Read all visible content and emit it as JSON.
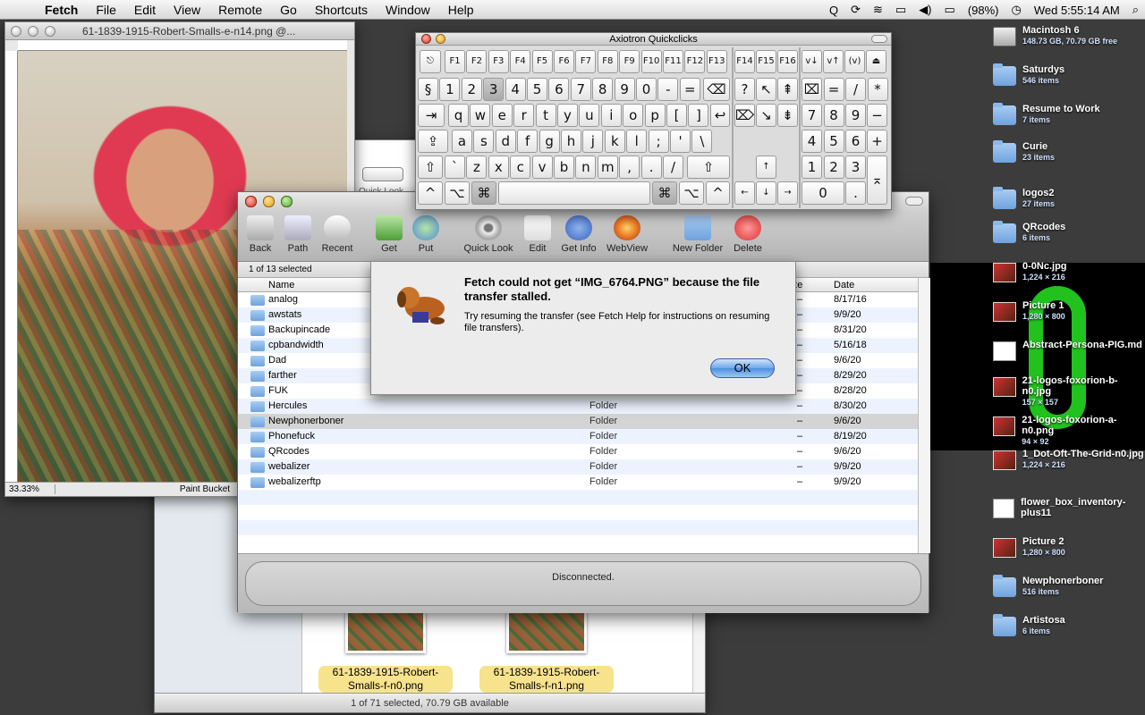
{
  "menubar": {
    "app": "Fetch",
    "items": [
      "File",
      "Edit",
      "View",
      "Remote",
      "Go",
      "Shortcuts",
      "Window",
      "Help"
    ],
    "battery": "(98%)",
    "clock": "Wed 5:55:14 AM"
  },
  "desktop": {
    "items": [
      {
        "name": "Macintosh 6",
        "sub": "148.73 GB, 70.79 GB free",
        "kind": "disk"
      },
      {
        "name": "Saturdys",
        "sub": "546 items",
        "kind": "folder"
      },
      {
        "name": "Resume to Work",
        "sub": "7 items",
        "kind": "folder"
      },
      {
        "name": "Curie",
        "sub": "23 items",
        "kind": "folder"
      },
      {
        "name": "logos2",
        "sub": "27 items",
        "kind": "folder"
      },
      {
        "name": "QRcodes",
        "sub": "6 items",
        "kind": "folder"
      },
      {
        "name": "0-0Nc.jpg",
        "sub": "1,224 × 216",
        "kind": "image"
      },
      {
        "name": "Picture 1",
        "sub": "1,280 × 800",
        "kind": "image"
      },
      {
        "name": "Abstract-Persona-PIG.md",
        "sub": "",
        "kind": "file"
      },
      {
        "name": "21-logos-foxorion-b-n0.jpg",
        "sub": "157 × 157",
        "kind": "image"
      },
      {
        "name": "21-logos-foxorion-a-n0.png",
        "sub": "94 × 92",
        "kind": "image"
      },
      {
        "name": "1_Dot-Oft-The-Grid-n0.jpg",
        "sub": "1,224 × 216",
        "kind": "image"
      },
      {
        "name": "flower_box_inventory-plus11",
        "sub": "",
        "kind": "file"
      },
      {
        "name": "Picture 2",
        "sub": "1,280 × 800",
        "kind": "image"
      },
      {
        "name": "Newphonerboner",
        "sub": "516 items",
        "kind": "folder"
      },
      {
        "name": "Artistosa",
        "sub": "6 items",
        "kind": "folder"
      }
    ]
  },
  "editor": {
    "title": "61-1839-1915-Robert-Smalls-e-n14.png @...",
    "zoom": "33.33%",
    "tool": "Paint Bucket"
  },
  "finder_back": {
    "quicklook": "Quick Look",
    "thumbs": [
      {
        "label": "61-1839-1915-Robert-Smalls-f-n0.png"
      },
      {
        "label": "61-1839-1915-Robert-Smalls-f-n1.png"
      }
    ],
    "status": "1 of 71 selected, 70.79 GB available"
  },
  "quickclicks": {
    "title": "Axiotron Quickclicks",
    "fkeys": [
      "F1",
      "F2",
      "F3",
      "F4",
      "F5",
      "F6",
      "F7",
      "F8",
      "F9",
      "F10",
      "F11",
      "F12",
      "F13",
      "F14",
      "F15",
      "F16"
    ],
    "num_row": [
      "§",
      "1",
      "2",
      "3",
      "4",
      "5",
      "6",
      "7",
      "8",
      "9",
      "0",
      "-",
      "="
    ],
    "q_row": [
      "q",
      "w",
      "e",
      "r",
      "t",
      "y",
      "u",
      "i",
      "o",
      "p",
      "[",
      "]"
    ],
    "a_row": [
      "a",
      "s",
      "d",
      "f",
      "g",
      "h",
      "j",
      "k",
      "l",
      ";",
      "'",
      "\\"
    ],
    "z_row": [
      "`",
      "z",
      "x",
      "c",
      "v",
      "b",
      "n",
      "m",
      ",",
      ".",
      "/"
    ],
    "keypad": [
      "7",
      "8",
      "9",
      "4",
      "5",
      "6",
      "1",
      "2",
      "3",
      "0",
      "."
    ]
  },
  "fetch": {
    "toolbar": [
      "Back",
      "Path",
      "Recent",
      "Get",
      "Put",
      "Quick Look",
      "Edit",
      "Get Info",
      "WebView",
      "New Folder",
      "Delete"
    ],
    "selection": "1 of 13 selected",
    "columns": {
      "name": "Name",
      "size": "Size",
      "date": "Date"
    },
    "rows": [
      {
        "name": "analog",
        "kind": "Folder",
        "size": "–",
        "date": "8/17/16"
      },
      {
        "name": "awstats",
        "kind": "Folder",
        "size": "–",
        "date": "9/9/20"
      },
      {
        "name": "Backupincade",
        "kind": "Folder",
        "size": "–",
        "date": "8/31/20"
      },
      {
        "name": "cpbandwidth",
        "kind": "Folder",
        "size": "–",
        "date": "5/16/18"
      },
      {
        "name": "Dad",
        "kind": "Folder",
        "size": "–",
        "date": "9/6/20"
      },
      {
        "name": "farther",
        "kind": "Folder",
        "size": "–",
        "date": "8/29/20"
      },
      {
        "name": "FUK",
        "kind": "Folder",
        "size": "–",
        "date": "8/28/20"
      },
      {
        "name": "Hercules",
        "kind": "Folder",
        "size": "–",
        "date": "8/30/20"
      },
      {
        "name": "Newphonerboner",
        "kind": "Folder",
        "size": "–",
        "date": "9/6/20"
      },
      {
        "name": "Phonefuck",
        "kind": "Folder",
        "size": "–",
        "date": "8/19/20"
      },
      {
        "name": "QRcodes",
        "kind": "Folder",
        "size": "–",
        "date": "9/6/20"
      },
      {
        "name": "webalizer",
        "kind": "Folder",
        "size": "–",
        "date": "9/9/20"
      },
      {
        "name": "webalizerftp",
        "kind": "Folder",
        "size": "–",
        "date": "9/9/20"
      }
    ],
    "status": "Disconnected."
  },
  "alert": {
    "heading": "Fetch could not get “IMG_6764.PNG” because the file transfer stalled.",
    "message": "Try resuming the transfer (see Fetch Help for instructions on resuming file transfers).",
    "ok": "OK"
  }
}
